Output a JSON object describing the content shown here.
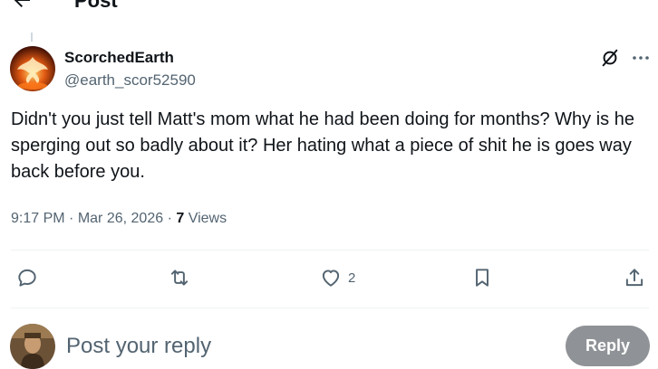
{
  "header": {
    "title": "Post",
    "back_icon": "arrow-left-icon"
  },
  "tweet": {
    "display_name": "ScorchedEarth",
    "handle": "@earth_scor52590",
    "text": "Didn't you just tell Matt's mom what he had been doing for months? Why is he sperging out so badly about it? Her hating what a piece of shit he is goes way back before you.",
    "time": "9:17 PM",
    "date": "Mar 26, 2026",
    "views_count": "7",
    "views_label": "Views",
    "separator": "·"
  },
  "actions": {
    "reply_icon": "comment-icon",
    "repost_icon": "repost-icon",
    "like_icon": "heart-icon",
    "like_count": "2",
    "bookmark_icon": "bookmark-icon",
    "share_icon": "share-icon"
  },
  "composer": {
    "placeholder": "Post your reply",
    "button_label": "Reply"
  },
  "colors": {
    "text": "#0f1419",
    "secondary": "#536471",
    "divider": "#eff3f4",
    "reply_button": "#8f9296"
  }
}
